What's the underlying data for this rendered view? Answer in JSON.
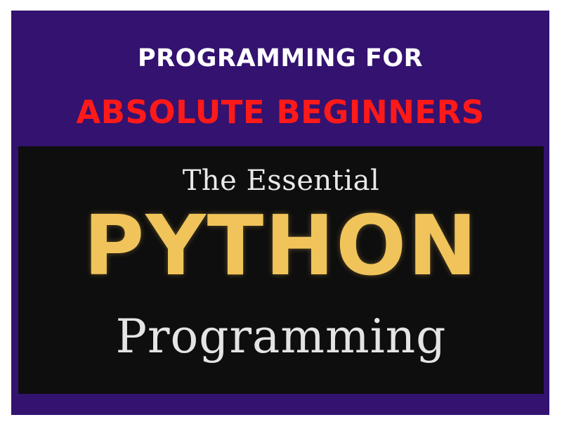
{
  "banner": {
    "line_1": "PROGRAMMING FOR",
    "line_2": "ABSOLUTE BEGINNERS"
  },
  "book_cover": {
    "line_1": "The Essential",
    "line_2": "PYTHON",
    "line_3": "Programming"
  },
  "colors": {
    "background_purple": "#331270",
    "headline_white": "#ffffff",
    "headline_red": "#ff1a1a",
    "cover_black": "#0e0e0e",
    "python_gold": "#f0c45a",
    "cover_text": "#e4e4e4"
  }
}
